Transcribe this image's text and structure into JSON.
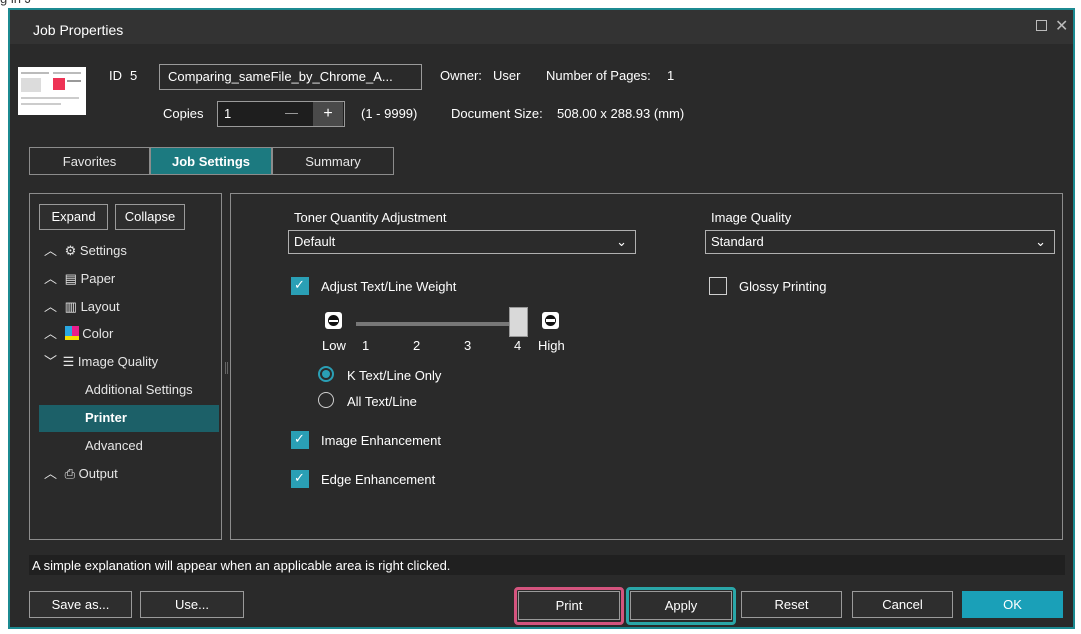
{
  "window": {
    "title": "Job Properties"
  },
  "header": {
    "id_label": "ID",
    "id_value": "5",
    "file_name": "Comparing_sameFile_by_Chrome_A...",
    "owner_label": "Owner:",
    "owner_value": "User",
    "pages_label": "Number of Pages:",
    "pages_value": "1",
    "copies_label": "Copies",
    "copies_value": "1",
    "copies_minus": "—",
    "copies_plus": "+",
    "copies_range": "(1 - 9999)",
    "docsize_label": "Document Size:",
    "docsize_value": "508.00 x 288.93 (mm)"
  },
  "tabs": [
    {
      "label": "Favorites"
    },
    {
      "label": "Job Settings"
    },
    {
      "label": "Summary"
    }
  ],
  "tree": {
    "expand_label": "Expand",
    "collapse_label": "Collapse",
    "items": [
      {
        "label": "Settings"
      },
      {
        "label": "Paper"
      },
      {
        "label": "Layout"
      },
      {
        "label": "Color"
      },
      {
        "label": "Image Quality"
      },
      {
        "label": "Additional Settings"
      },
      {
        "label": "Printer"
      },
      {
        "label": "Advanced"
      },
      {
        "label": "Output"
      }
    ]
  },
  "settings": {
    "toner_label": "Toner Quantity Adjustment",
    "toner_value": "Default",
    "iq_label": "Image Quality",
    "iq_value": "Standard",
    "adjust_text_label": "Adjust Text/Line Weight",
    "glossy_label": "Glossy Printing",
    "slider": {
      "low": "Low",
      "high": "High",
      "ticks": [
        "1",
        "2",
        "3",
        "4"
      ],
      "value": 4
    },
    "radio_k": "K Text/Line Only",
    "radio_all": "All Text/Line",
    "image_enh_label": "Image Enhancement",
    "edge_enh_label": "Edge Enhancement"
  },
  "status": {
    "text": "A simple explanation will appear when an applicable area is right clicked."
  },
  "footer": {
    "save_as": "Save as...",
    "use": "Use...",
    "print": "Print",
    "apply": "Apply",
    "reset": "Reset",
    "cancel": "Cancel",
    "ok": "OK"
  },
  "colors": {
    "accent": "#1c7a80",
    "ok_button": "#1aa0b8",
    "print_highlight": "#d4547e",
    "apply_highlight": "#2aa6a8"
  }
}
